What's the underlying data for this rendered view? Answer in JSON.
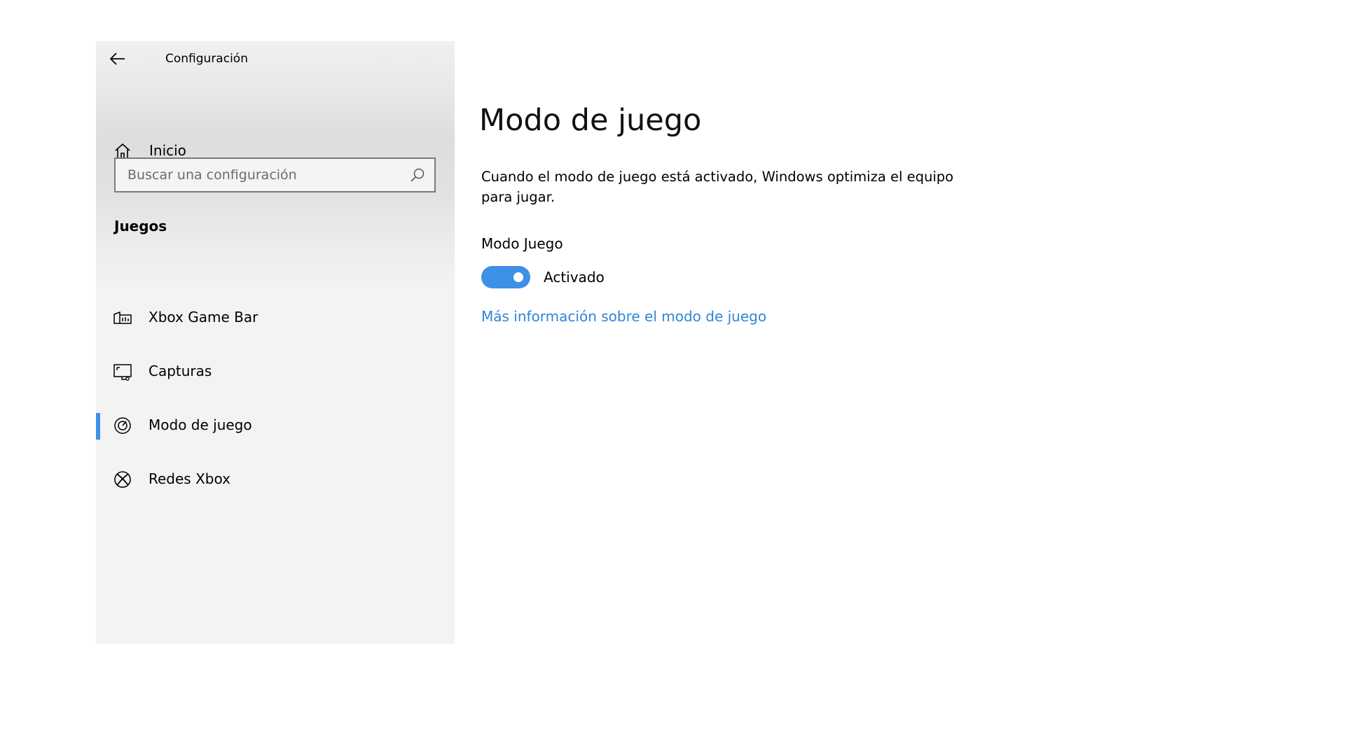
{
  "window": {
    "title": "Configuración"
  },
  "sidebar": {
    "home_label": "Inicio",
    "search": {
      "placeholder": "Buscar una configuración",
      "value": ""
    },
    "section_label": "Juegos",
    "items": [
      {
        "label": "Xbox Game Bar",
        "icon": "game-bar-icon",
        "selected": false
      },
      {
        "label": "Capturas",
        "icon": "captures-icon",
        "selected": false
      },
      {
        "label": "Modo de juego",
        "icon": "game-mode-icon",
        "selected": true
      },
      {
        "label": "Redes Xbox",
        "icon": "xbox-icon",
        "selected": false
      }
    ],
    "accent_color": "#3d8fe8"
  },
  "main": {
    "title": "Modo de juego",
    "description": "Cuando el modo de juego está activado, Windows optimiza el equipo para jugar.",
    "setting": {
      "label": "Modo Juego",
      "state_label": "Activado",
      "enabled": true
    },
    "link": "Más información sobre el modo de juego",
    "link_color": "#2e86d8"
  }
}
